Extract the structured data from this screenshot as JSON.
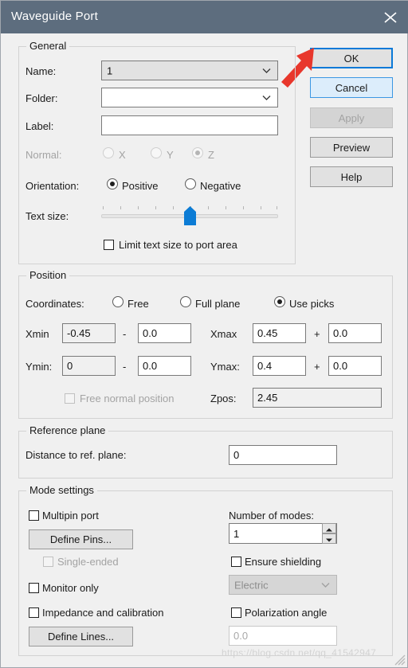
{
  "window": {
    "title": "Waveguide Port",
    "close_icon": "close-icon",
    "titlebar_color": "#5d6d7e"
  },
  "buttons": {
    "ok": "OK",
    "cancel": "Cancel",
    "apply": "Apply",
    "preview": "Preview",
    "help": "Help"
  },
  "general": {
    "title": "General",
    "name_label": "Name:",
    "name_value": "1",
    "folder_label": "Folder:",
    "folder_value": "",
    "label_label": "Label:",
    "label_value": "",
    "normal_label": "Normal:",
    "normal_options": [
      "X",
      "Y",
      "Z"
    ],
    "normal_selected": "Z",
    "orientation_label": "Orientation:",
    "orientation_options": [
      "Positive",
      "Negative"
    ],
    "orientation_selected": "Positive",
    "text_size_label": "Text size:",
    "text_size_value": 5,
    "text_size_min": 0,
    "text_size_max": 10,
    "limit_text_label": "Limit text size to port area",
    "limit_text_checked": false
  },
  "position": {
    "title": "Position",
    "coordinates_label": "Coordinates:",
    "coordinates_options": [
      "Free",
      "Full plane",
      "Use picks"
    ],
    "coordinates_selected": "Use picks",
    "xmin_label": "Xmin",
    "xmin_value": "-0.45",
    "xmin_op": "-",
    "xmin_offset": "0.0",
    "xmax_label": "Xmax",
    "xmax_value": "0.45",
    "xmax_op": "+",
    "xmax_offset": "0.0",
    "ymin_label": "Ymin:",
    "ymin_value": "0",
    "ymin_op": "-",
    "ymin_offset": "0.0",
    "ymax_label": "Ymax:",
    "ymax_value": "0.4",
    "ymax_op": "+",
    "ymax_offset": "0.0",
    "free_normal_label": "Free normal position",
    "free_normal_checked": false,
    "zpos_label": "Zpos:",
    "zpos_value": "2.45"
  },
  "reference_plane": {
    "title": "Reference plane",
    "distance_label": "Distance to ref. plane:",
    "distance_value": "0"
  },
  "mode_settings": {
    "title": "Mode settings",
    "multipin_label": "Multipin port",
    "multipin_checked": false,
    "define_pins": "Define Pins...",
    "single_ended_label": "Single-ended",
    "single_ended_checked": false,
    "monitor_only_label": "Monitor only",
    "monitor_only_checked": false,
    "impedance_label": "Impedance and calibration",
    "impedance_checked": false,
    "define_lines": "Define Lines...",
    "modes_label": "Number of modes:",
    "modes_value": "1",
    "ensure_shielding_label": "Ensure shielding",
    "ensure_shielding_checked": false,
    "shielding_type": "Electric",
    "polarization_label": "Polarization angle",
    "polarization_checked": false,
    "polarization_value": "0.0"
  },
  "annotation": {
    "arrow_color": "#e8372c"
  },
  "watermark": "https://blog.csdn.net/qq_41542947"
}
